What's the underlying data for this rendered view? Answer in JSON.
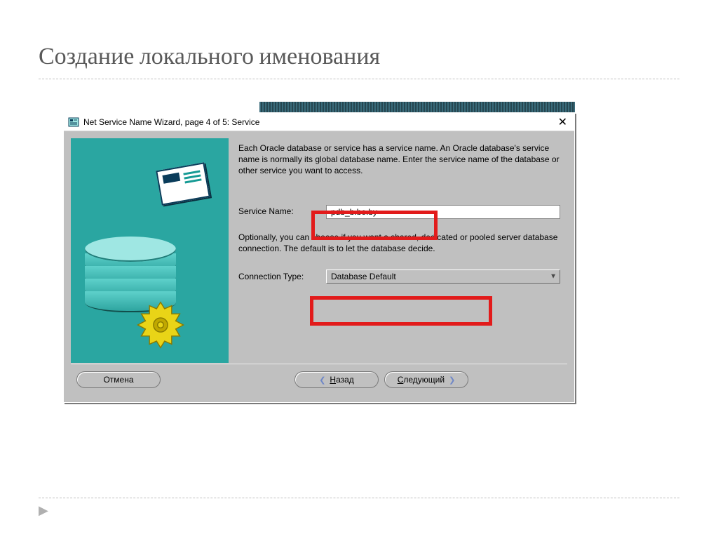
{
  "slide": {
    "title": "Создание локального именования"
  },
  "dialog": {
    "title": "Net Service Name Wizard, page 4 of 5: Service",
    "instruction": "Each Oracle database or service has a service name. An Oracle database's service name is normally its global database name. Enter the service name of the database or other service you want to access.",
    "service_name_label": "Service Name:",
    "service_name_value": "pdb_b.be.by",
    "optional_text": "Optionally, you can choose if you want a shared, dedicated or pooled server database connection. The default is to let the database decide.",
    "connection_type_label": "Connection Type:",
    "connection_type_value": "Database Default"
  },
  "buttons": {
    "cancel": "Отмена",
    "back_u": "Н",
    "back_rest": "азад",
    "next_u": "С",
    "next_rest": "ледующий"
  }
}
